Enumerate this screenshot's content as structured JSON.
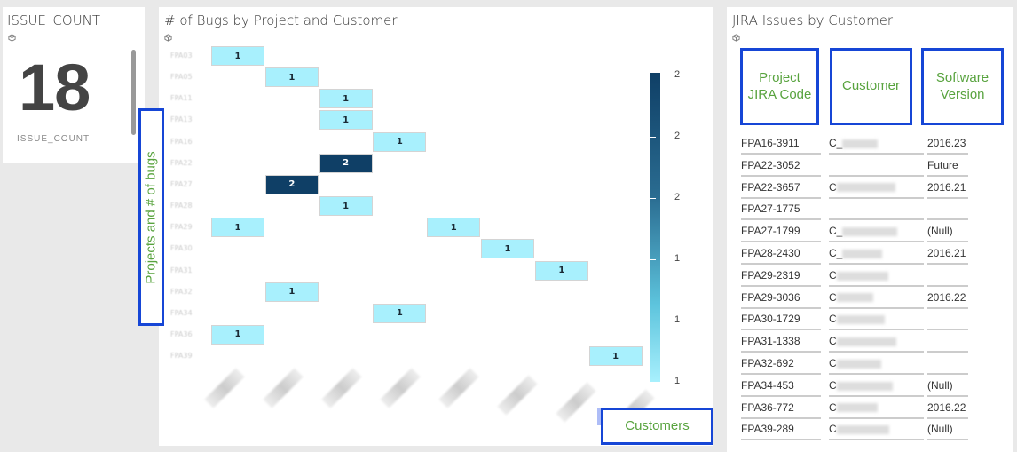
{
  "kpi": {
    "title": "ISSUE_COUNT",
    "value": "18",
    "caption": "ISSUE_COUNT"
  },
  "heatmap": {
    "title": "# of Bugs by Project and Customer",
    "rows": [
      "FPA03",
      "FPA05",
      "FPA11",
      "FPA13",
      "FPA16",
      "FPA22",
      "FPA27",
      "FPA28",
      "FPA29",
      "FPA30",
      "FPA31",
      "FPA32",
      "FPA34",
      "FPA36",
      "FPA39"
    ],
    "cells": [
      {
        "row": 0,
        "col": 0,
        "value": "1"
      },
      {
        "row": 1,
        "col": 1,
        "value": "1"
      },
      {
        "row": 2,
        "col": 2,
        "value": "1"
      },
      {
        "row": 3,
        "col": 2,
        "value": "1"
      },
      {
        "row": 4,
        "col": 3,
        "value": "1"
      },
      {
        "row": 5,
        "col": 2,
        "value": "2"
      },
      {
        "row": 6,
        "col": 1,
        "value": "2"
      },
      {
        "row": 7,
        "col": 2,
        "value": "1"
      },
      {
        "row": 8,
        "col": 0,
        "value": "1"
      },
      {
        "row": 8,
        "col": 4,
        "value": "1"
      },
      {
        "row": 9,
        "col": 5,
        "value": "1"
      },
      {
        "row": 10,
        "col": 6,
        "value": "1"
      },
      {
        "row": 11,
        "col": 1,
        "value": "1"
      },
      {
        "row": 12,
        "col": 3,
        "value": "1"
      },
      {
        "row": 13,
        "col": 0,
        "value": "1"
      },
      {
        "row": 14,
        "col": 7,
        "value": "1"
      }
    ],
    "legend_labels": [
      "2",
      "2",
      "2",
      "1",
      "1",
      "1"
    ],
    "colors": {
      "low": "#a8f0fd",
      "high": "#0f3f66"
    },
    "annotation_rows": "Projects and # of bugs",
    "annotation_cols": "Customers"
  },
  "table": {
    "title": "JIRA Issues by Customer",
    "headers": [
      "Project JIRA Code",
      "Customer",
      "Software Version"
    ],
    "rows": [
      {
        "code": "FPA16-3911",
        "customer": "C_",
        "version": "2016.23"
      },
      {
        "code": "FPA22-3052",
        "customer": "",
        "version": "Future"
      },
      {
        "code": "FPA22-3657",
        "customer": "C",
        "version": "2016.21"
      },
      {
        "code": "FPA27-1775",
        "customer": "",
        "version": ""
      },
      {
        "code": "FPA27-1799",
        "customer": "C_",
        "version": "(Null)"
      },
      {
        "code": "FPA28-2430",
        "customer": "C_",
        "version": "2016.21"
      },
      {
        "code": "FPA29-2319",
        "customer": "C",
        "version": ""
      },
      {
        "code": "FPA29-3036",
        "customer": "C",
        "version": "2016.22"
      },
      {
        "code": "FPA30-1729",
        "customer": "C",
        "version": ""
      },
      {
        "code": "FPA31-1338",
        "customer": "C",
        "version": ""
      },
      {
        "code": "FPA32-692",
        "customer": "C",
        "version": ""
      },
      {
        "code": "FPA34-453",
        "customer": "C",
        "version": "(Null)"
      },
      {
        "code": "FPA36-772",
        "customer": "C",
        "version": "2016.22"
      },
      {
        "code": "FPA39-289",
        "customer": "C",
        "version": "(Null)"
      }
    ]
  }
}
